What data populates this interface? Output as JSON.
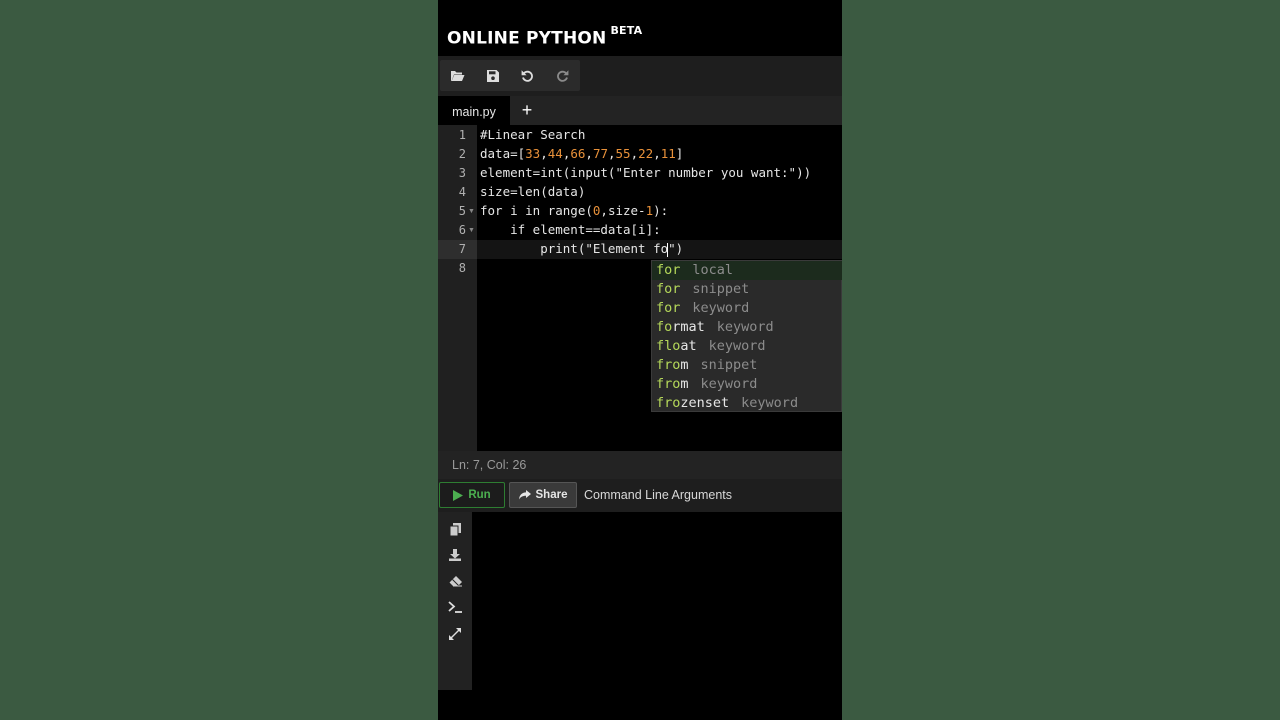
{
  "app": {
    "title": "ONLINE PYTHON",
    "badge": "BETA"
  },
  "toolbar": {
    "icons": [
      "folder-open-icon",
      "save-icon",
      "undo-icon",
      "redo-icon"
    ]
  },
  "tabs": {
    "active": "main.py",
    "add": "+"
  },
  "editor": {
    "line_numbers": [
      "1",
      "2",
      "3",
      "4",
      "5",
      "6",
      "7",
      "8"
    ],
    "lines": [
      "#Linear Search",
      "data=[33,44,66,77,55,22,11]",
      "element=int(input(\"Enter number you want:\"))",
      "size=len(data)",
      "for i in range(0,size-1):",
      "    if element==data[i]:",
      "        print(\"Element fo\")",
      ""
    ]
  },
  "autocomplete": [
    {
      "match": "for",
      "rest": "",
      "meta": "local"
    },
    {
      "match": "for",
      "rest": "",
      "meta": "snippet"
    },
    {
      "match": "for",
      "rest": "",
      "meta": "keyword"
    },
    {
      "match": "fo",
      "rest": "rmat",
      "meta": "keyword",
      "split": "f|o|rmat"
    },
    {
      "match": "flo",
      "rest": "at",
      "meta": "keyword"
    },
    {
      "match": "fro",
      "rest": "m",
      "meta": "snippet"
    },
    {
      "match": "fro",
      "rest": "m",
      "meta": "keyword"
    },
    {
      "match": "fro",
      "rest": "zenset",
      "meta": "keyword"
    }
  ],
  "status": {
    "text": "Ln: 7,  Col: 26"
  },
  "runbar": {
    "run_label": "Run",
    "share_label": "Share",
    "args_placeholder": "Command Line Arguments"
  },
  "colors": {
    "background": "#3b5a41",
    "run_green": "#4caf50",
    "match_green": "#b5d85a",
    "number_orange": "#e8913a"
  }
}
